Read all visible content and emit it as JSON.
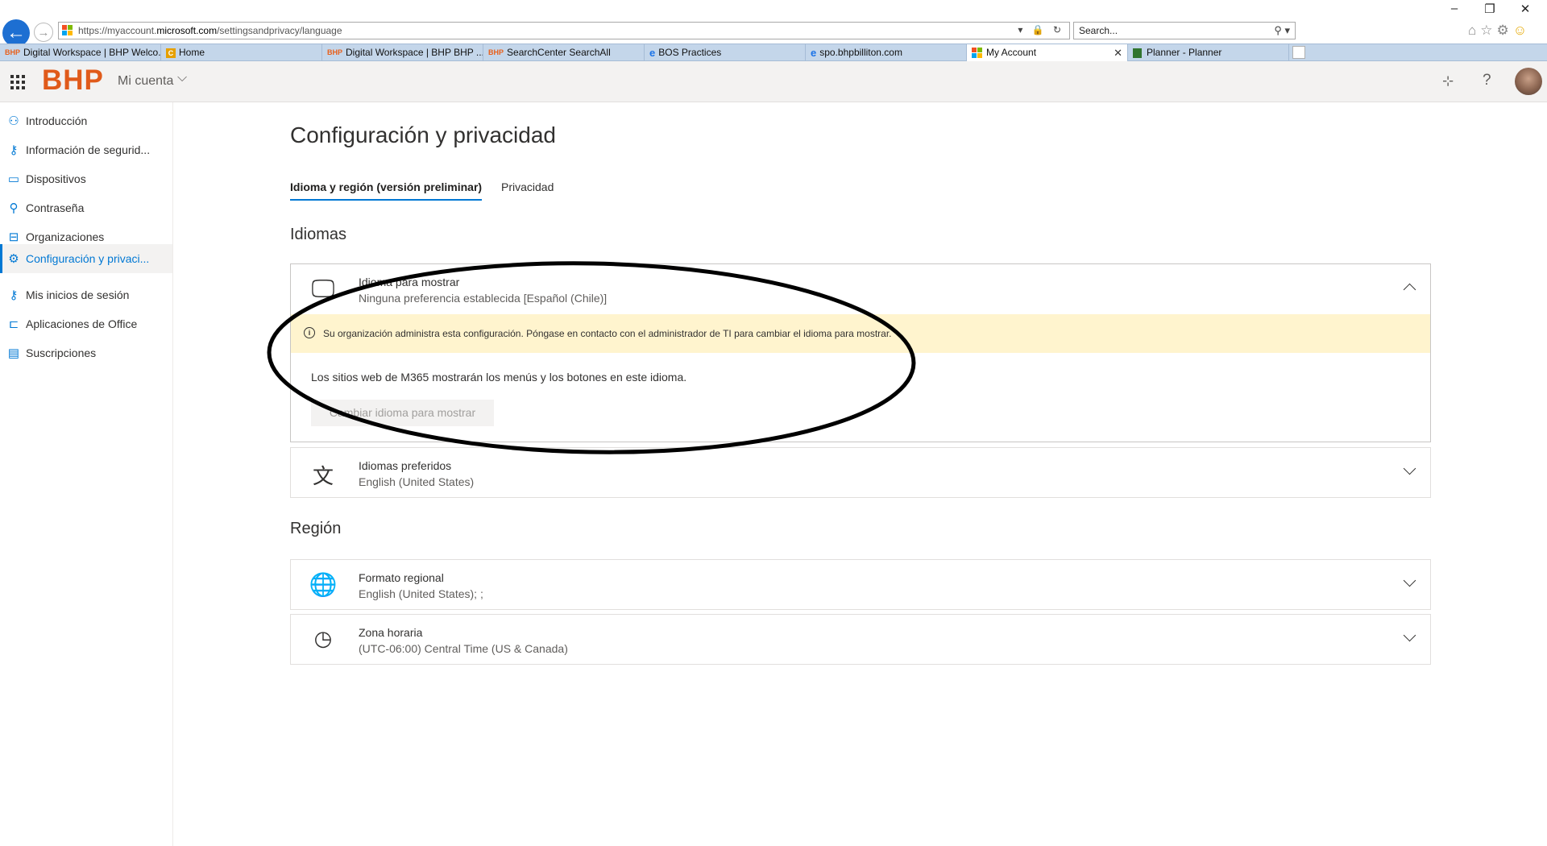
{
  "browser": {
    "url_prefix": "https://myaccount.",
    "url_domain": "microsoft.com",
    "url_path": "/settingsandprivacy/language",
    "search_placeholder": "Search...",
    "tabs": [
      {
        "label": "Digital Workspace | BHP Welco..."
      },
      {
        "label": "Home"
      },
      {
        "label": "Digital Workspace | BHP BHP ..."
      },
      {
        "label": "SearchCenter SearchAll"
      },
      {
        "label": "BOS Practices"
      },
      {
        "label": "spo.bhpbilliton.com"
      },
      {
        "label": "My Account"
      },
      {
        "label": "Planner - Planner"
      }
    ],
    "tab_fav_bhp": "BHP"
  },
  "header": {
    "logo": "BHP",
    "title": "Mi cuenta"
  },
  "sidebar": {
    "items": [
      {
        "label": "Introducción"
      },
      {
        "label": "Información de segurid..."
      },
      {
        "label": "Dispositivos"
      },
      {
        "label": "Contraseña"
      },
      {
        "label": "Organizaciones"
      },
      {
        "label": "Configuración y privaci..."
      },
      {
        "label": "Mis inicios de sesión"
      },
      {
        "label": "Aplicaciones de Office"
      },
      {
        "label": "Suscripciones"
      }
    ]
  },
  "main": {
    "title": "Configuración y privacidad",
    "tabs": [
      "Idioma y región (versión preliminar)",
      "Privacidad"
    ],
    "languages_heading": "Idiomas",
    "display_language": {
      "title": "Idioma para mostrar",
      "subtitle": "Ninguna preferencia establecida [Español (Chile)]",
      "warning": "Su organización administra esta configuración. Póngase en contacto con el administrador de TI para cambiar el idioma para mostrar.",
      "body": "Los sitios web de M365 mostrarán los menús y los botones en este idioma.",
      "button": "Cambiar idioma para mostrar"
    },
    "preferred_languages": {
      "title": "Idiomas preferidos",
      "subtitle": "English (United States)"
    },
    "region_heading": "Región",
    "regional_format": {
      "title": "Formato regional",
      "subtitle": "English (United States); ;"
    },
    "time_zone": {
      "title": "Zona horaria",
      "subtitle": "(UTC-06:00) Central Time (US & Canada)"
    }
  },
  "colors": {
    "accent": "#0078d4",
    "brand": "#e05a1a",
    "warning_bg": "#fff4ce"
  }
}
